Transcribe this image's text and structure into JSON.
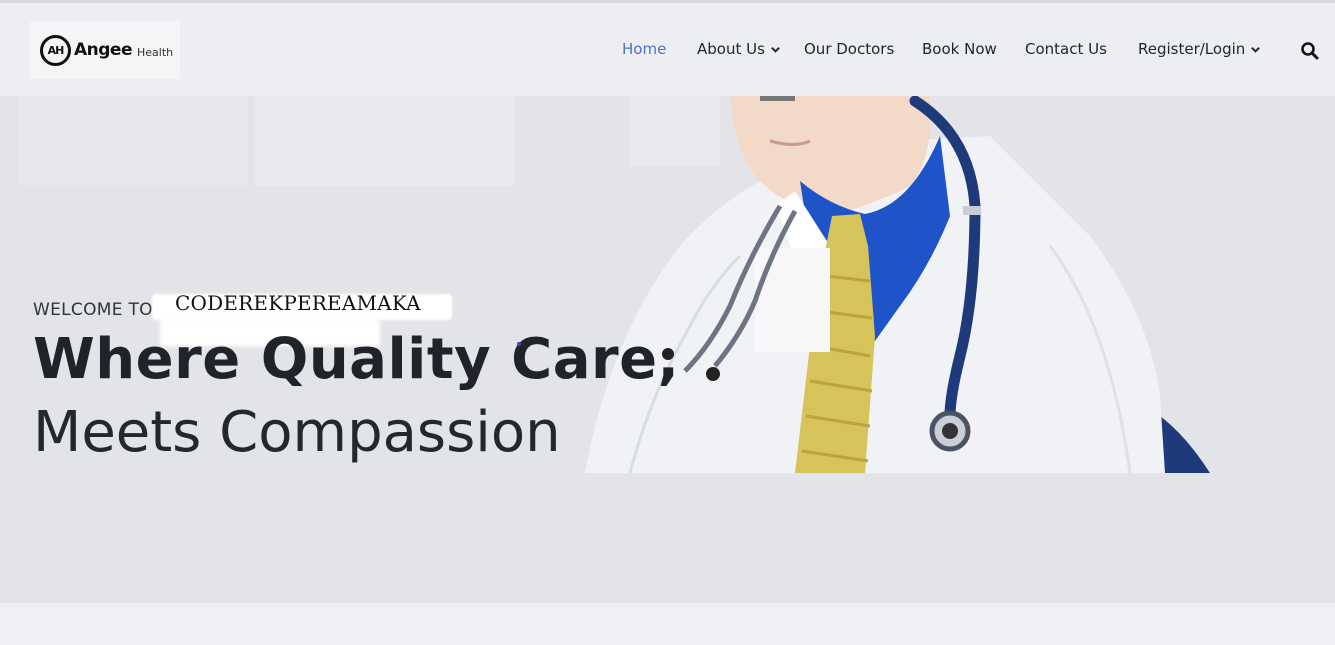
{
  "header": {
    "logo": {
      "mark": "AH",
      "name": "Angee",
      "sub": "Health"
    },
    "nav": [
      {
        "label": "Home",
        "active": true,
        "dropdown": false
      },
      {
        "label": "About Us",
        "active": false,
        "dropdown": true
      },
      {
        "label": "Our Doctors",
        "active": false,
        "dropdown": false
      },
      {
        "label": "Book Now",
        "active": false,
        "dropdown": false
      },
      {
        "label": "Contact Us",
        "active": false,
        "dropdown": false
      },
      {
        "label": "Register/Login",
        "active": false,
        "dropdown": true
      }
    ],
    "search_icon": "search-icon"
  },
  "hero": {
    "welcome": "WELCOME TO",
    "brand_overlay": "CODEREKPEREAMAKA",
    "headline_line1": "Where Quality Care,",
    "headline_line2": "Meets Compassion"
  },
  "colors": {
    "accent": "#4c73c8",
    "text": "#1f232a",
    "coat_blue": "#1f54c9",
    "tie_yellow": "#d6c35a",
    "stethoscope": "#1f3a7a"
  }
}
